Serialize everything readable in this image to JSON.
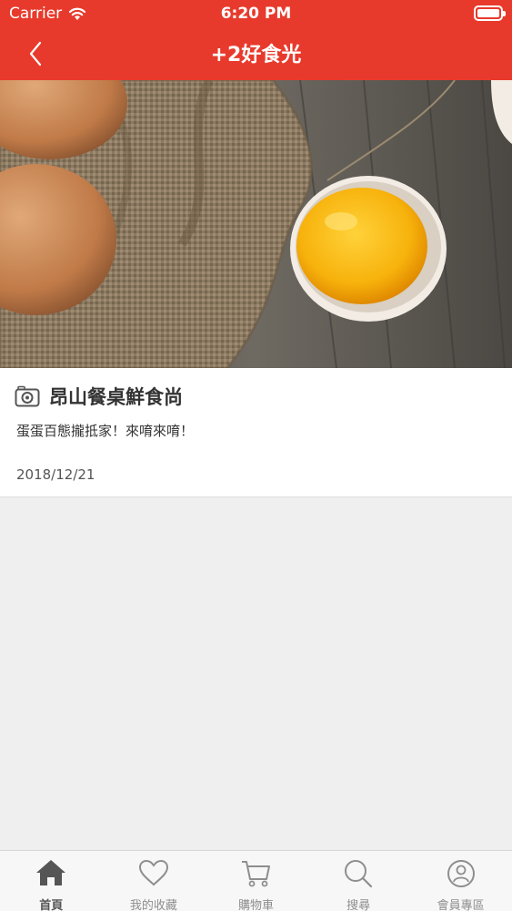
{
  "status_bar": {
    "carrier": "Carrier",
    "time": "6:20 PM"
  },
  "nav_bar": {
    "title": "+2好食光",
    "back_icon": "chevron-left-icon",
    "color": "#e83a2c"
  },
  "hero_image": {
    "subject": "brown eggs on burlap with cracked egg yolk on wooden table"
  },
  "article": {
    "icon": "camera-icon",
    "title": "昂山餐桌鮮食尚",
    "description": "蛋蛋百態攏抵家！來唷來唷！",
    "date": "2018/12/21"
  },
  "tab_bar": {
    "items": [
      {
        "label": "首頁",
        "icon": "home-icon",
        "active": true
      },
      {
        "label": "我的收藏",
        "icon": "heart-icon",
        "active": false
      },
      {
        "label": "購物車",
        "icon": "cart-icon",
        "active": false
      },
      {
        "label": "搜尋",
        "icon": "search-icon",
        "active": false
      },
      {
        "label": "會員專區",
        "icon": "user-icon",
        "active": false
      }
    ]
  }
}
